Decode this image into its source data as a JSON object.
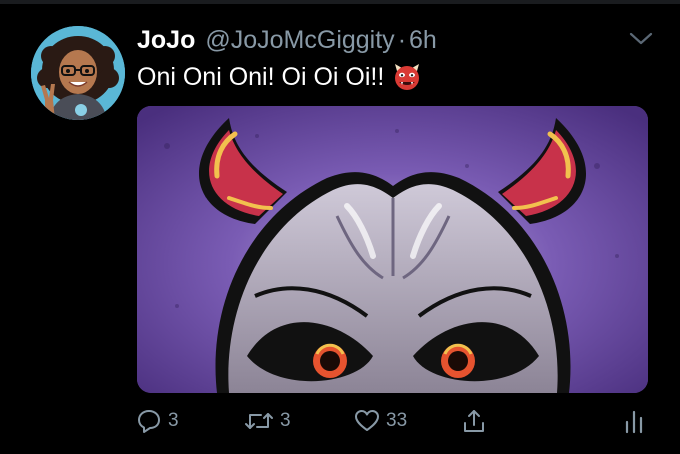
{
  "tweet": {
    "display_name": "JoJo",
    "handle": "@JoJoMcGiggity",
    "separator": "·",
    "timestamp": "6h",
    "text": "Oni Oni Oni! Oi Oi Oi!!",
    "emoji_icon": "ogre-emoji-icon",
    "media_description_icon": "oni-demon-image"
  },
  "actions": {
    "reply_count": "3",
    "retweet_count": "3",
    "like_count": "33"
  },
  "colors": {
    "background": "#000000",
    "primary_text": "#ffffff",
    "secondary_text": "#8899a6",
    "media_purple": "#6b4ea0",
    "horn_red": "#c8324a"
  }
}
